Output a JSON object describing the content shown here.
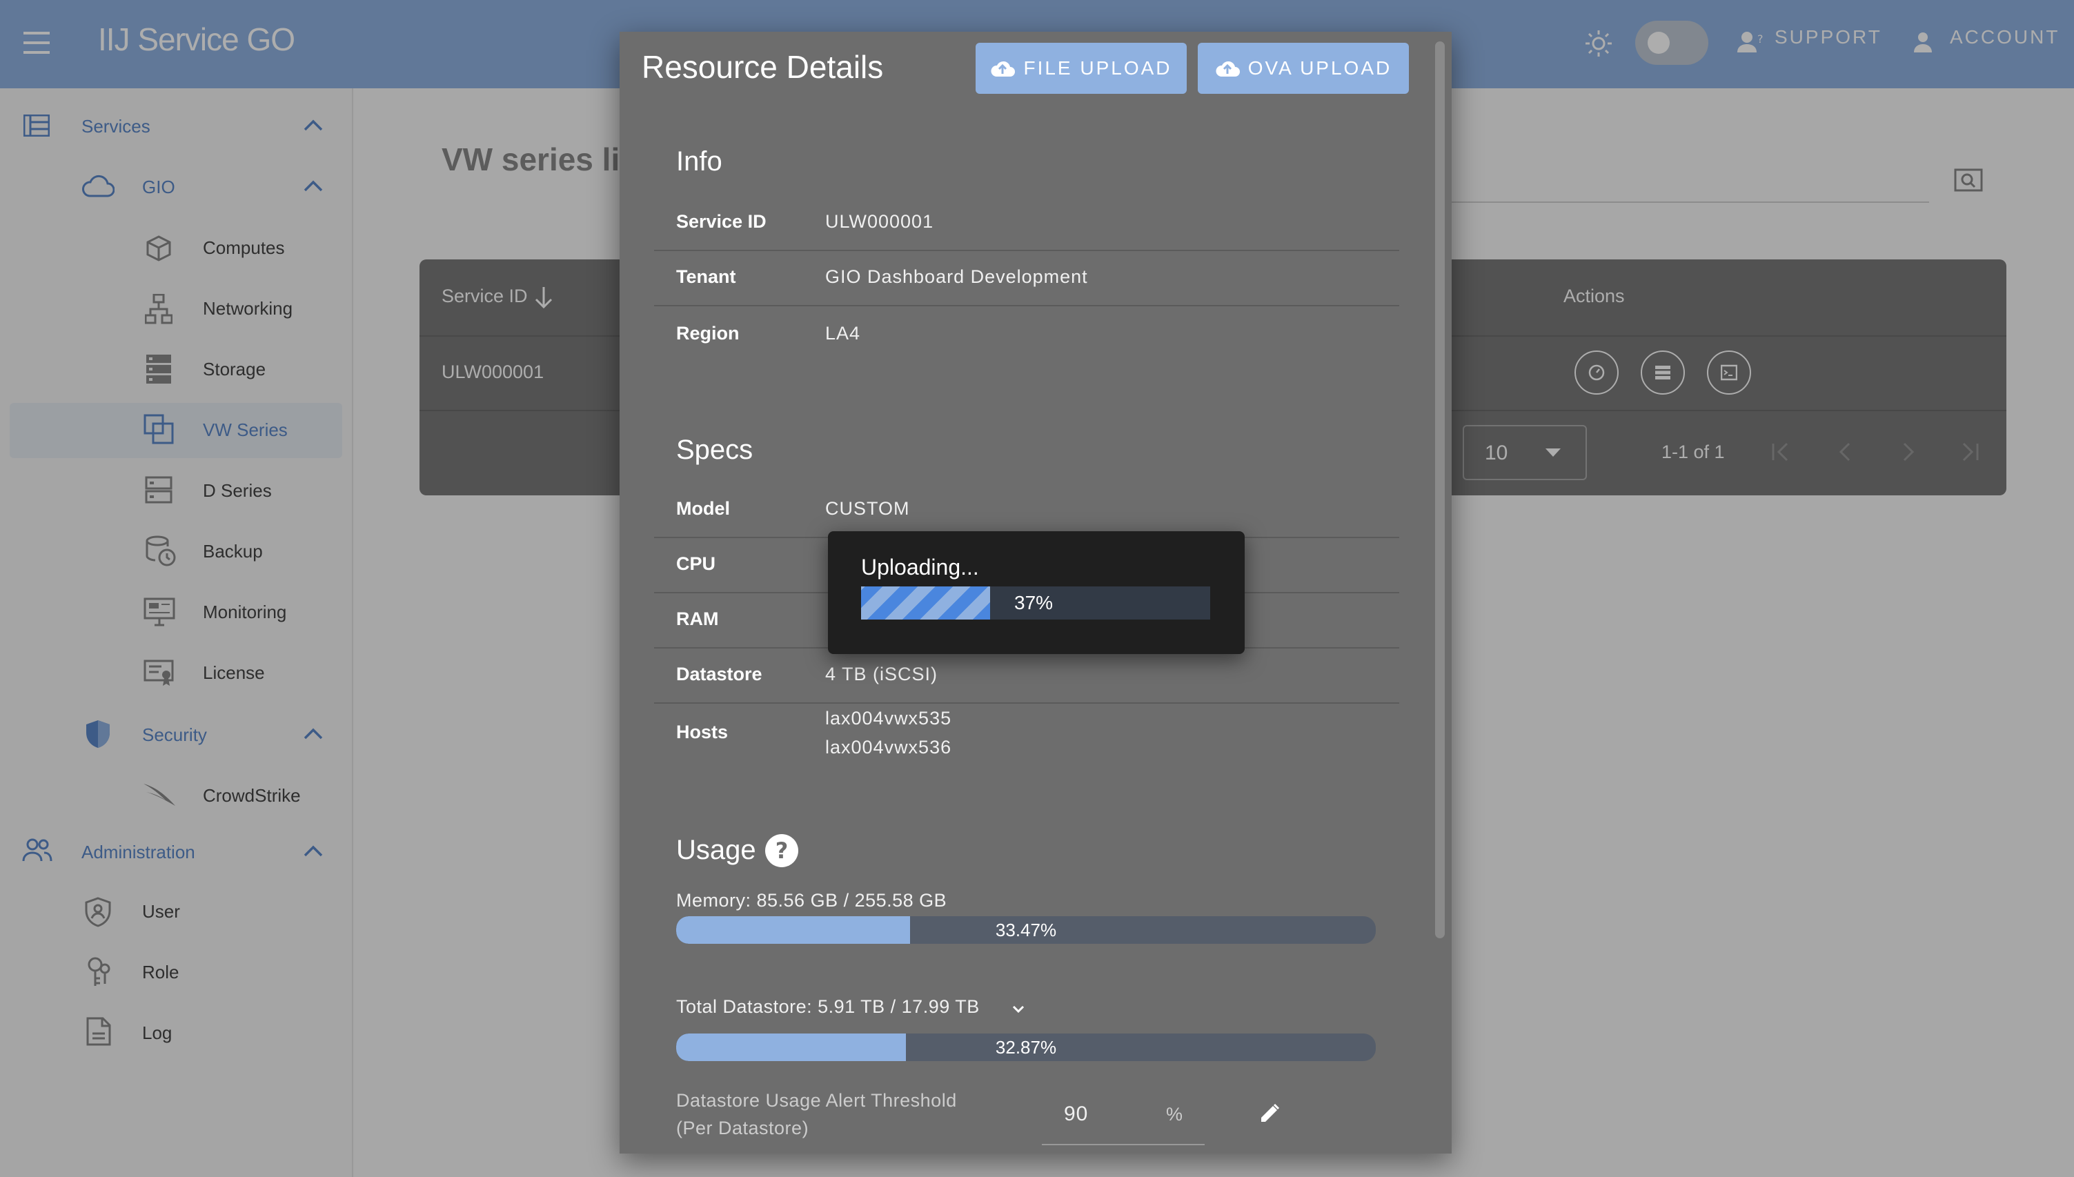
{
  "header": {
    "app_title": "IIJ Service GO",
    "support_label": "SUPPORT",
    "account_label": "ACCOUNT"
  },
  "sidebar": {
    "services_label": "Services",
    "gio_label": "GIO",
    "gio_items": [
      "Computes",
      "Networking",
      "Storage",
      "VW Series",
      "D Series",
      "Backup",
      "Monitoring",
      "License"
    ],
    "security_label": "Security",
    "security_items": [
      "CrowdStrike"
    ],
    "administration_label": "Administration",
    "administration_items": [
      "User",
      "Role",
      "Log"
    ],
    "active_item": "VW Series"
  },
  "main": {
    "title": "VW series li",
    "table": {
      "col_service_id": "Service ID",
      "col_actions": "Actions",
      "rows": [
        {
          "service_id": "ULW000001"
        }
      ]
    },
    "pagination": {
      "per_page": "10",
      "range": "1-1 of 1"
    }
  },
  "dialog": {
    "title": "Resource Details",
    "file_upload_label": "FILE UPLOAD",
    "ova_upload_label": "OVA UPLOAD",
    "info": {
      "heading": "Info",
      "service_id_label": "Service ID",
      "service_id": "ULW000001",
      "tenant_label": "Tenant",
      "tenant": "GIO Dashboard Development",
      "region_label": "Region",
      "region": "LA4"
    },
    "specs": {
      "heading": "Specs",
      "model_label": "Model",
      "model": "CUSTOM",
      "cpu_label": "CPU",
      "ram_label": "RAM",
      "datastore_label": "Datastore",
      "datastore": "4 TB (iSCSI)",
      "hosts_label": "Hosts",
      "host_1": "lax004vwx535",
      "host_2": "lax004vwx536"
    },
    "usage": {
      "heading": "Usage",
      "memory_label": "Memory: 85.56 GB / 255.58 GB",
      "memory_percent_text": "33.47%",
      "memory_fraction": 0.3347,
      "datastore_label": "Total Datastore: 5.91 TB / 17.99 TB",
      "datastore_percent_text": "32.87%",
      "datastore_fraction": 0.3287,
      "threshold_label_1": "Datastore Usage Alert Threshold",
      "threshold_label_2": "(Per Datastore)",
      "threshold_value": "90",
      "threshold_unit": "%"
    }
  },
  "upload_toast": {
    "status": "Uploading...",
    "percent_text": "37%",
    "fraction": 0.37
  },
  "colors": {
    "accent": "#8fb1e0",
    "sidebar_active_text": "#5a86c7",
    "dialog_bg": "#6d6d6d",
    "toast_bg": "#1f1f1f"
  }
}
